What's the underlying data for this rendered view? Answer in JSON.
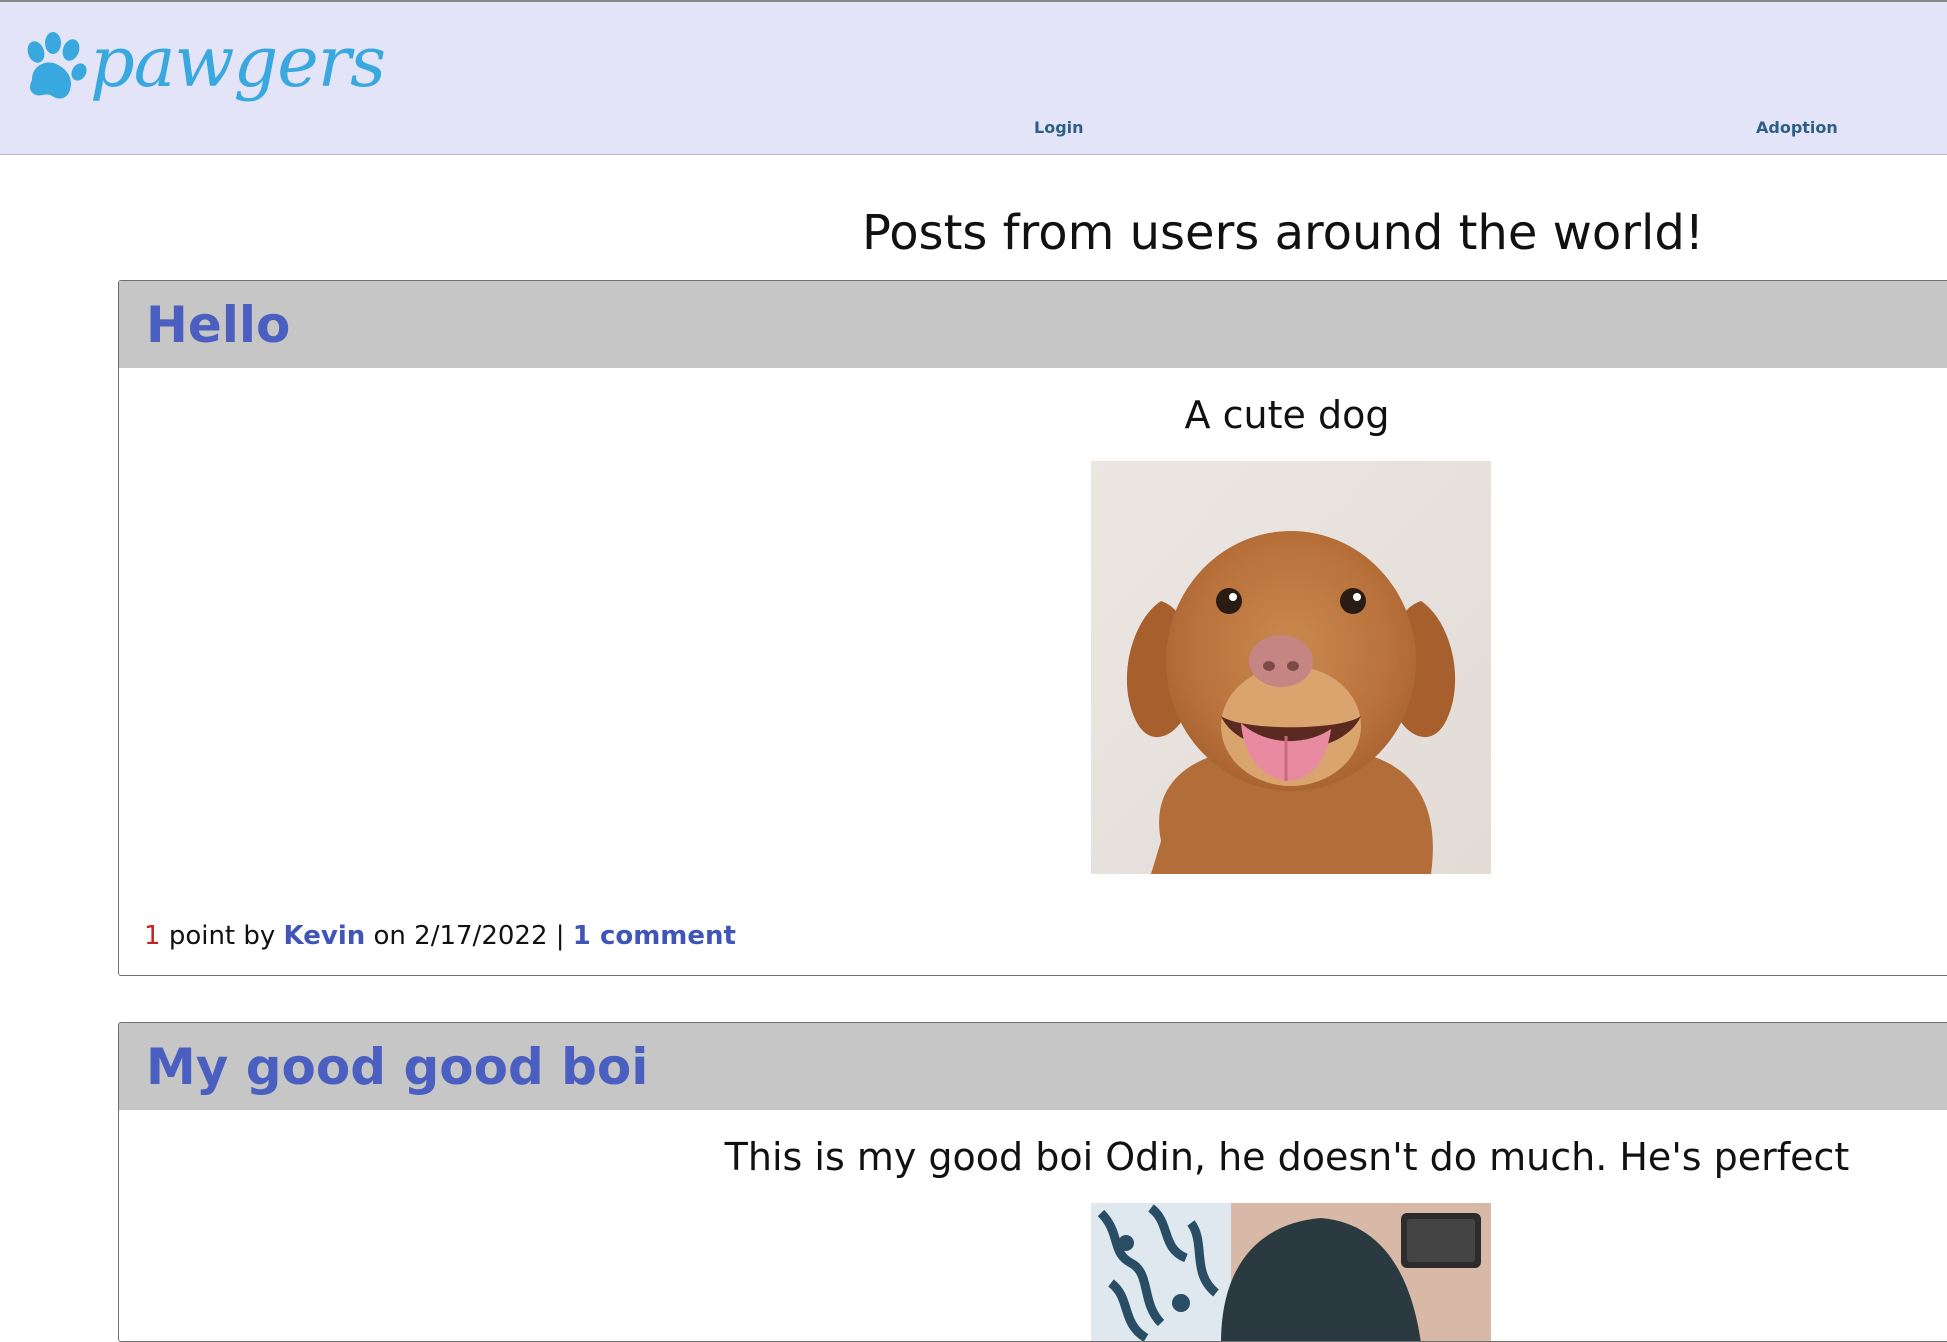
{
  "header": {
    "logo_text": "pawgers",
    "nav": {
      "login": "Login",
      "adoption": "Adoption"
    }
  },
  "main": {
    "heading": "Posts from users around the world!",
    "posts": [
      {
        "title": "Hello",
        "description": "A cute dog",
        "points": "1",
        "points_label": "point by",
        "author": "Kevin",
        "date_prefix": "on",
        "date": "2/17/2022",
        "separator": "|",
        "comments": "1 comment"
      },
      {
        "title": "My good good boi",
        "description": "This is my good boi Odin, he doesn't do much. He's perfect"
      }
    ]
  },
  "colors": {
    "header_bg": "#e4e4f8",
    "logo": "#39a8de",
    "nav_link": "#2e5f86",
    "post_header_bg": "#c6c6c6",
    "post_title": "#4a5fc0",
    "points": "#c42323"
  }
}
